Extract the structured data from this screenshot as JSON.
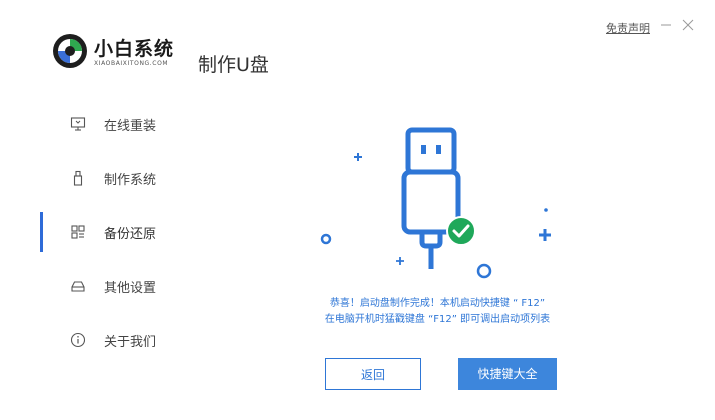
{
  "header": {
    "logo_title": "小白系统",
    "logo_subtitle": "XIAOBAIXITONG.COM",
    "app_title": "制作U盘",
    "disclaimer": "免责声明",
    "minimize_glyph": "–",
    "close_glyph": "×"
  },
  "sidebar": {
    "items": [
      {
        "label": "在线重装",
        "icon": "monitor-icon",
        "active": false
      },
      {
        "label": "制作系统",
        "icon": "usb-drive-icon",
        "active": false
      },
      {
        "label": "备份还原",
        "icon": "grid-icon",
        "active": true
      },
      {
        "label": "其他设置",
        "icon": "tray-icon",
        "active": false
      },
      {
        "label": "关于我们",
        "icon": "info-icon",
        "active": false
      }
    ]
  },
  "main": {
    "message_line1": "恭喜！启动盘制作完成！本机启动快捷键 “ F12”",
    "message_line2": "在电脑开机时猛戳键盘 “F12” 即可调出启动项列表",
    "back_button": "返回",
    "shortcuts_button": "快捷键大全"
  },
  "colors": {
    "accent": "#2e76d6",
    "button_fill": "#3d86dc",
    "success": "#1fa85a"
  }
}
